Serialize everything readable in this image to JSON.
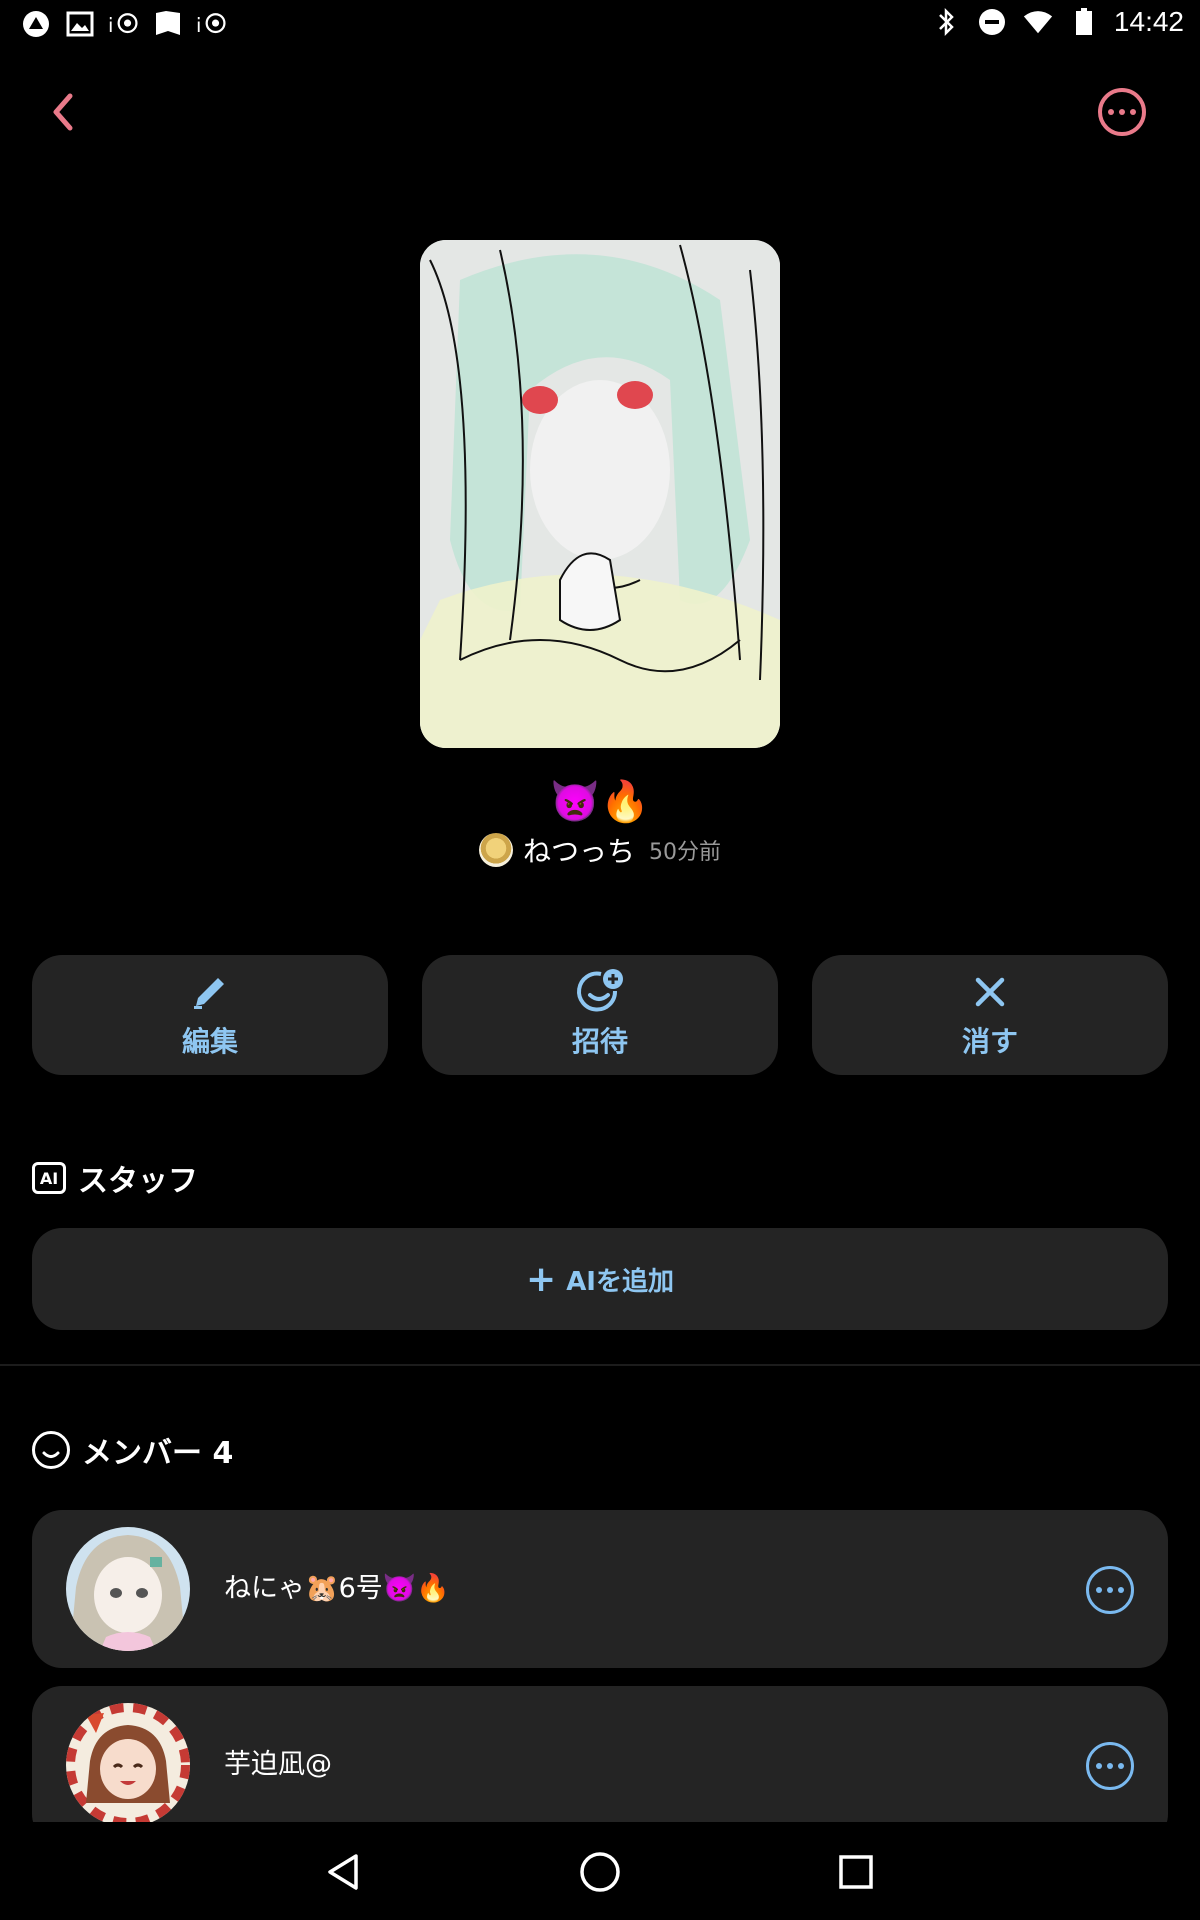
{
  "status_bar": {
    "time": "14:42",
    "left_icons": [
      "app-icon",
      "image-icon",
      "ip-icon",
      "book-icon",
      "ip-icon"
    ],
    "right_icons": [
      "bluetooth-icon",
      "dnd-icon",
      "wifi-icon",
      "battery-icon"
    ]
  },
  "header": {
    "back_icon": "chevron-left-icon",
    "more_icon": "more-circle-icon",
    "accent": "#e97a8a"
  },
  "post": {
    "title": "👿🔥",
    "author": "ねつっち",
    "time": "50分前"
  },
  "actions": [
    {
      "label": "編集",
      "icon": "pencil-icon"
    },
    {
      "label": "招待",
      "icon": "invite-icon"
    },
    {
      "label": "消す",
      "icon": "close-icon"
    }
  ],
  "staff": {
    "badge": "AI",
    "title": "スタッフ",
    "add_label": "AIを追加",
    "add_plus": "+"
  },
  "members": {
    "title": "メンバー 4",
    "items": [
      {
        "name": "ねにゃ🐹6号👿🔥"
      },
      {
        "name": "芋迫凪@"
      }
    ]
  },
  "colors": {
    "button_text": "#8ec6f1",
    "card_bg": "#242424",
    "muted": "#9a9a9a"
  },
  "nav": [
    "back-nav-icon",
    "home-nav-icon",
    "recents-nav-icon"
  ]
}
